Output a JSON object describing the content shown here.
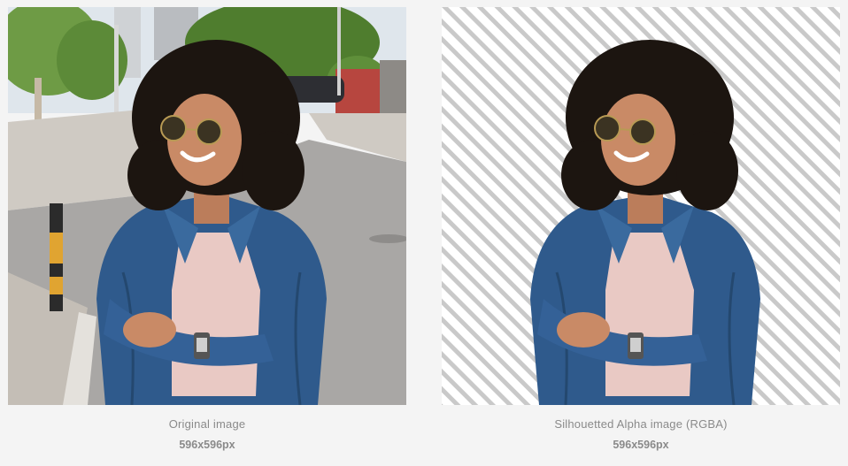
{
  "panels": [
    {
      "image_kind": "street-photo-woman",
      "caption": "Original image",
      "dimensions": "596x596px"
    },
    {
      "image_kind": "cutout-on-transparency-stripes",
      "caption": "Silhouetted Alpha image (RGBA)",
      "dimensions": "596x596px"
    }
  ],
  "colors": {
    "page_background": "#f4f4f4",
    "caption_text": "#8a8a8a",
    "stripe_light": "#ffffff",
    "stripe_dark": "#c9c9c9",
    "denim": "#2f5a8c",
    "hair": "#1c1510",
    "skin": "#c98a66",
    "shirt": "#e9c9c4",
    "sky": "#dfe6ec",
    "road": "#a9a7a5",
    "sidewalk": "#cfcac3",
    "foliage": "#5f8f3a"
  }
}
